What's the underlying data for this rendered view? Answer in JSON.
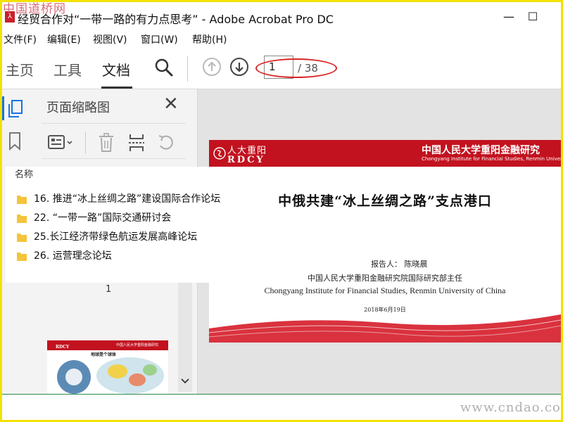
{
  "watermark_top": "中国道桥网",
  "watermark_bottom": "www.cndao.com",
  "window": {
    "title": "经贸合作对“一带一路的有力点思考” - Adobe Acrobat Pro DC",
    "minimize_glyph": "—",
    "maximize_glyph": "☐"
  },
  "menu": [
    {
      "label": "文件(F)"
    },
    {
      "label": "编辑(E)"
    },
    {
      "label": "视图(V)"
    },
    {
      "label": "窗口(W)"
    },
    {
      "label": "帮助(H)"
    }
  ],
  "toolbar": {
    "tabs": [
      "主页",
      "工具",
      "文档"
    ],
    "active_tab": "文档",
    "page_current": "1",
    "page_total": "/ 38"
  },
  "thumbnail_panel": {
    "title": "页面缩略图",
    "page_number": "1"
  },
  "overlay": {
    "header": "名称",
    "items": [
      "16. 推进“冰上丝绸之路”建设国际合作论坛",
      "22. “一带一路”国际交通研讨会",
      "25.长江经济带绿色航运发展高峰论坛",
      "26. 运营理念论坛"
    ]
  },
  "slide": {
    "logo_cn": "人大重阳",
    "logo_en": "RDCY",
    "institute_cn": "中国人民大学重阳金融研究",
    "institute_en": "Chongyang Institute for Financial Studies, Renmin University of Ch",
    "title": "中俄共建“冰上丝绸之路”支点港口",
    "reporter": "报告人：  陈晓晨",
    "affiliation": "中国人民大学重阳金融研究院国际研究部主任",
    "affiliation_en": "Chongyang Institute for Financial Studies, Renmin University of China",
    "date": "2018年6月19日"
  },
  "thumbnail2": {
    "header_cn": "中国人民大学重阳金融研究",
    "logo_en": "RDCY",
    "caption": "地球是个球体"
  },
  "colors": {
    "frame": "#f3e100",
    "slide_red": "#c2121f",
    "annotation_red": "#d82424",
    "accent_blue": "#1473e6",
    "folder": "#f4c43a"
  }
}
